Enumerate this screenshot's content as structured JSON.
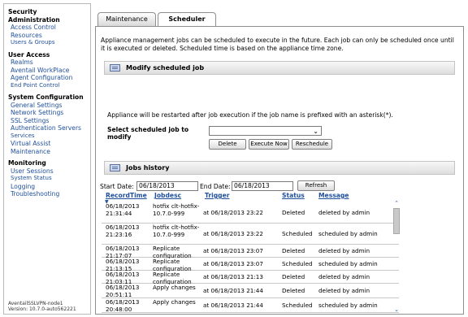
{
  "sidebar": {
    "sections": [
      {
        "title": "Security Administration",
        "items": [
          "Access Control",
          "Resources",
          "Users & Groups"
        ]
      },
      {
        "title": "User Access",
        "items": [
          "Realms",
          "Aventail WorkPlace",
          "Agent Configuration",
          "End Point Control"
        ]
      },
      {
        "title": "System Configuration",
        "items": [
          "General Settings",
          "Network Settings",
          "SSL Settings",
          "Authentication Servers",
          "Services",
          "Virtual Assist",
          "Maintenance"
        ]
      },
      {
        "title": "Monitoring",
        "items": [
          "User Sessions",
          "System Status",
          "Logging",
          "Troubleshooting"
        ]
      }
    ],
    "device_name": "AventailSSLVPN-node1",
    "version": "Version: 10.7.0-auto562221"
  },
  "tabs": [
    {
      "label": "Maintenance",
      "active": false
    },
    {
      "label": "Scheduler",
      "active": true
    }
  ],
  "intro_text": "Appliance management jobs can be scheduled to execute in the future. Each job can only be scheduled once until it is executed or deleted. Scheduled time is based on the appliance time zone.",
  "modify_section": {
    "title": "Modify scheduled job",
    "restart_note": "Appliance will be restarted after job execution if the job name is prefixed with an asterisk(*).",
    "select_label": "Select scheduled job to modify",
    "select_value": "",
    "buttons": {
      "delete": "Delete",
      "execute": "Execute Now",
      "reschedule": "Reschedule"
    }
  },
  "history_section": {
    "title": "Jobs history",
    "start_label": "Start Date:",
    "start_value": "06/18/2013",
    "end_label": "End Date:",
    "end_value": "06/18/2013",
    "refresh_label": "Refresh",
    "columns": [
      "RecordTime",
      "Jobdesc",
      "Trigger",
      "Status",
      "Message"
    ],
    "rows": [
      {
        "record_time": "06/18/2013 21:31:44",
        "jobdesc": "hotfix clt-hotfix-10.7.0-999",
        "trigger": "at 06/18/2013 23:22",
        "status": "Deleted",
        "message": "deleted by admin"
      },
      {
        "record_time": "06/18/2013 21:23:16",
        "jobdesc": "hotfix clt-hotfix-10.7.0-999",
        "trigger": "at 06/18/2013 23:22",
        "status": "Scheduled",
        "message": "scheduled by admin"
      },
      {
        "record_time": "06/18/2013 21:17:07",
        "jobdesc": "Replicate configuration",
        "trigger": "at 06/18/2013 23:07",
        "status": "Deleted",
        "message": "deleted by admin"
      },
      {
        "record_time": "06/18/2013 21:13:15",
        "jobdesc": "Replicate configuration",
        "trigger": "at 06/18/2013 23:07",
        "status": "Scheduled",
        "message": "scheduled by admin"
      },
      {
        "record_time": "06/18/2013 21:03:11",
        "jobdesc": "Replicate configuration",
        "trigger": "at 06/18/2013 21:13",
        "status": "Deleted",
        "message": "deleted by admin"
      },
      {
        "record_time": "06/18/2013 20:51:11",
        "jobdesc": "Apply changes",
        "trigger": "at 06/18/2013 21:44",
        "status": "Deleted",
        "message": "deleted by admin"
      },
      {
        "record_time": "06/18/2013 20:48:00",
        "jobdesc": "Apply changes",
        "trigger": "at 06/18/2013 21:44",
        "status": "Scheduled",
        "message": "scheduled by admin"
      }
    ]
  },
  "colors": {
    "link": "#1f4f9c",
    "border": "#8e8e8e",
    "section_bar": "#dedede"
  },
  "icons": {
    "section": "scheduler-section-icon",
    "sort": "sort-arrow-down-icon",
    "dropdown": "chevron-down-icon",
    "scroll_up": "scroll-up-icon",
    "scroll_down": "scroll-down-icon"
  }
}
